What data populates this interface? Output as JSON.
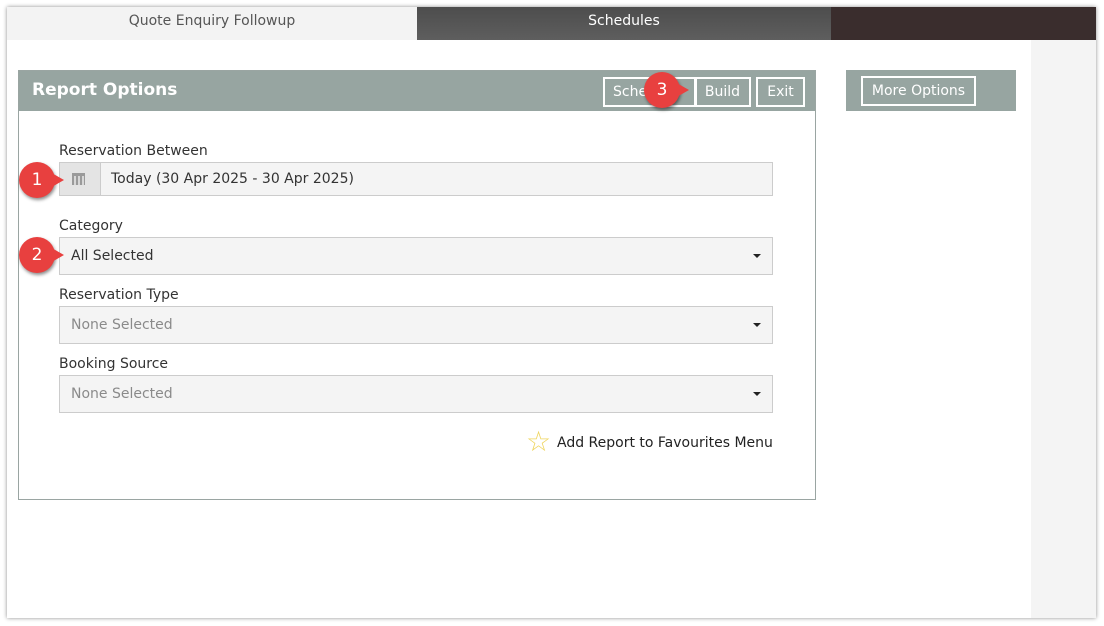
{
  "tabs": [
    {
      "label": "Quote Enquiry Followup",
      "active": false
    },
    {
      "label": "Schedules",
      "active": true
    }
  ],
  "panel": {
    "title": "Report Options",
    "buttons": {
      "schedule": "Sche",
      "build": "Build",
      "exit": "Exit"
    }
  },
  "form": {
    "reservation_between": {
      "label": "Reservation Between",
      "value": "Today (30 Apr 2025 - 30 Apr 2025)"
    },
    "category": {
      "label": "Category",
      "value": "All Selected"
    },
    "reservation_type": {
      "label": "Reservation Type",
      "value": "None Selected"
    },
    "booking_source": {
      "label": "Booking Source",
      "value": "None Selected"
    },
    "favourites": {
      "label": "Add Report to Favourites Menu",
      "icon": "star-icon"
    }
  },
  "sidebar": {
    "more_options": "More Options"
  },
  "badges": [
    "1",
    "2",
    "3"
  ],
  "colors": {
    "header": "#97a5a1",
    "active_tab": "#555555",
    "badge": "#e8403f",
    "star": "#efd55f"
  }
}
